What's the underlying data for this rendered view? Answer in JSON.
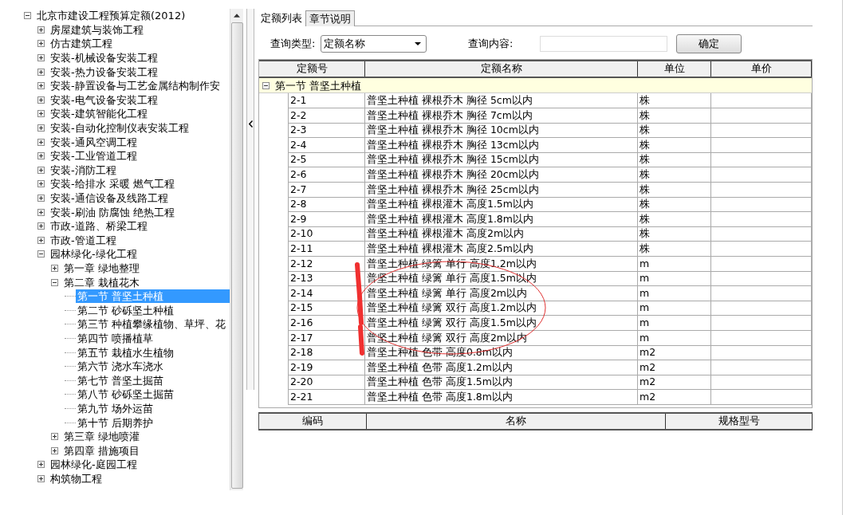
{
  "tree": {
    "items": [
      {
        "label": "北京市建设工程预算定额(2012)",
        "expanded": true,
        "selected": false,
        "children": [
          {
            "label": "房屋建筑与装饰工程",
            "expanded": false,
            "selected": false
          },
          {
            "label": "仿古建筑工程",
            "expanded": false,
            "selected": false
          },
          {
            "label": "安装-机械设备安装工程",
            "expanded": false,
            "selected": false
          },
          {
            "label": "安装-热力设备安装工程",
            "expanded": false,
            "selected": false
          },
          {
            "label": "安装-静置设备与工艺金属结构制作安",
            "expanded": false,
            "selected": false
          },
          {
            "label": "安装-电气设备安装工程",
            "expanded": false,
            "selected": false
          },
          {
            "label": "安装-建筑智能化工程",
            "expanded": false,
            "selected": false
          },
          {
            "label": "安装-自动化控制仪表安装工程",
            "expanded": false,
            "selected": false
          },
          {
            "label": "安装-通风空调工程",
            "expanded": false,
            "selected": false
          },
          {
            "label": "安装-工业管道工程",
            "expanded": false,
            "selected": false
          },
          {
            "label": "安装-消防工程",
            "expanded": false,
            "selected": false
          },
          {
            "label": "安装-给排水 采暖 燃气工程",
            "expanded": false,
            "selected": false
          },
          {
            "label": "安装-通信设备及线路工程",
            "expanded": false,
            "selected": false
          },
          {
            "label": "安装-刷油 防腐蚀 绝热工程",
            "expanded": false,
            "selected": false
          },
          {
            "label": "市政-道路、桥梁工程",
            "expanded": false,
            "selected": false
          },
          {
            "label": "市政-管道工程",
            "expanded": false,
            "selected": false
          },
          {
            "label": "园林绿化-绿化工程",
            "expanded": true,
            "selected": false,
            "children": [
              {
                "label": "第一章 绿地整理",
                "expanded": false,
                "selected": false
              },
              {
                "label": "第二章 栽植花木",
                "expanded": true,
                "selected": false,
                "children": [
                  {
                    "label": "第一节 普坚土种植",
                    "selected": true
                  },
                  {
                    "label": "第二节 砂砾坚土种植",
                    "selected": false
                  },
                  {
                    "label": "第三节 种植攀缘植物、草坪、花",
                    "selected": false
                  },
                  {
                    "label": "第四节 喷播植草",
                    "selected": false
                  },
                  {
                    "label": "第五节 栽植水生植物",
                    "selected": false
                  },
                  {
                    "label": "第六节 浇水车浇水",
                    "selected": false
                  },
                  {
                    "label": "第七节 普坚土掘苗",
                    "selected": false
                  },
                  {
                    "label": "第八节 砂砾坚土掘苗",
                    "selected": false
                  },
                  {
                    "label": "第九节 场外运苗",
                    "selected": false
                  },
                  {
                    "label": "第十节 后期养护",
                    "selected": false
                  }
                ]
              },
              {
                "label": "第三章 绿地喷灌",
                "expanded": false,
                "selected": false
              },
              {
                "label": "第四章 措施项目",
                "expanded": false,
                "selected": false
              }
            ]
          },
          {
            "label": "园林绿化-庭园工程",
            "expanded": false,
            "selected": false
          },
          {
            "label": "构筑物工程",
            "expanded": false,
            "selected": false
          }
        ]
      }
    ]
  },
  "tabs": [
    {
      "label": "定额列表",
      "selected": true
    },
    {
      "label": "章节说明",
      "selected": false
    }
  ],
  "query": {
    "type_label": "查询类型:",
    "type_value": "定额名称",
    "content_label": "查询内容:",
    "confirm_button": "确定"
  },
  "grid": {
    "columns": [
      "定额号",
      "定额名称",
      "单位",
      "单价"
    ],
    "group": {
      "label": "第一节 普坚土种植",
      "expanded": true
    },
    "rows": [
      {
        "code": "2-1",
        "name": "普坚土种植 裸根乔木 胸径 5cm以内",
        "unit": "株"
      },
      {
        "code": "2-2",
        "name": "普坚土种植 裸根乔木 胸径 7cm以内",
        "unit": "株"
      },
      {
        "code": "2-3",
        "name": "普坚土种植 裸根乔木 胸径 10cm以内",
        "unit": "株"
      },
      {
        "code": "2-4",
        "name": "普坚土种植 裸根乔木 胸径 13cm以内",
        "unit": "株"
      },
      {
        "code": "2-5",
        "name": "普坚土种植 裸根乔木 胸径 15cm以内",
        "unit": "株"
      },
      {
        "code": "2-6",
        "name": "普坚土种植 裸根乔木 胸径 20cm以内",
        "unit": "株"
      },
      {
        "code": "2-7",
        "name": "普坚土种植 裸根乔木 胸径 25cm以内",
        "unit": "株"
      },
      {
        "code": "2-8",
        "name": "普坚土种植 裸根灌木 高度1.5m以内",
        "unit": "株"
      },
      {
        "code": "2-9",
        "name": "普坚土种植 裸根灌木 高度1.8m以内",
        "unit": "株"
      },
      {
        "code": "2-10",
        "name": "普坚土种植 裸根灌木 高度2m以内",
        "unit": "株"
      },
      {
        "code": "2-11",
        "name": "普坚土种植 裸根灌木 高度2.5m以内",
        "unit": "株"
      },
      {
        "code": "2-12",
        "name": "普坚土种植 绿篱 单行 高度1.2m以内",
        "unit": "m"
      },
      {
        "code": "2-13",
        "name": "普坚土种植 绿篱 单行 高度1.5m以内",
        "unit": "m"
      },
      {
        "code": "2-14",
        "name": "普坚土种植 绿篱 单行 高度2m以内",
        "unit": "m"
      },
      {
        "code": "2-15",
        "name": "普坚土种植 绿篱 双行 高度1.2m以内",
        "unit": "m"
      },
      {
        "code": "2-16",
        "name": "普坚土种植 绿篱 双行 高度1.5m以内",
        "unit": "m"
      },
      {
        "code": "2-17",
        "name": "普坚土种植 绿篱 双行 高度2m以内",
        "unit": "m"
      },
      {
        "code": "2-18",
        "name": "普坚土种植 色带 高度0.8m以内",
        "unit": "m2"
      },
      {
        "code": "2-19",
        "name": "普坚土种植 色带 高度1.2m以内",
        "unit": "m2"
      },
      {
        "code": "2-20",
        "name": "普坚土种植 色带 高度1.5m以内",
        "unit": "m2"
      },
      {
        "code": "2-21",
        "name": "普坚土种植 色带 高度1.8m以内",
        "unit": "m2"
      }
    ]
  },
  "detail_table": {
    "columns": [
      "编码",
      "名称",
      "规格型号"
    ]
  }
}
